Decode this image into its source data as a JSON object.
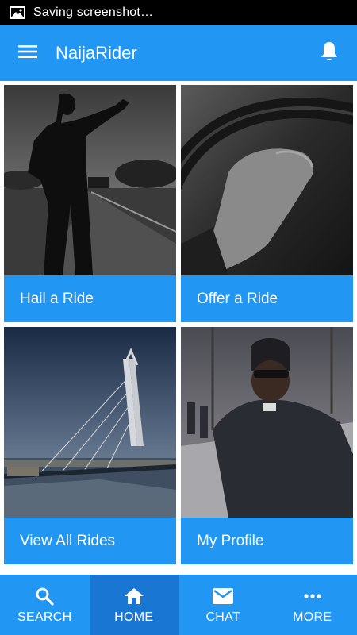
{
  "status_bar": {
    "icon": "image-icon",
    "text": "Saving screenshot…"
  },
  "app_bar": {
    "title": "NaijaRider",
    "menu_icon": "menu-icon",
    "notification_icon": "bell-icon",
    "color": "#2196f3"
  },
  "tiles": [
    {
      "label": "Hail a Ride"
    },
    {
      "label": "Offer a Ride"
    },
    {
      "label": "View All Rides"
    },
    {
      "label": "My Profile"
    }
  ],
  "bottom_nav": {
    "active": "HOME",
    "items": [
      {
        "label": "SEARCH",
        "icon": "search-icon"
      },
      {
        "label": "HOME",
        "icon": "home-icon"
      },
      {
        "label": "CHAT",
        "icon": "mail-icon"
      },
      {
        "label": "MORE",
        "icon": "more-icon"
      }
    ]
  }
}
